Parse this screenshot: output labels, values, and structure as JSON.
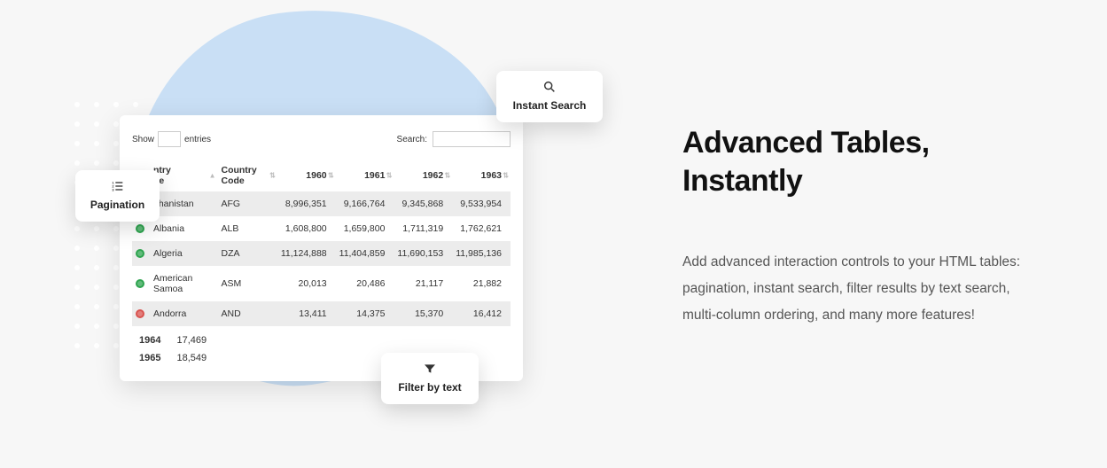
{
  "heading": "Advanced Tables, Instantly",
  "description": "Add advanced interaction controls to your HTML tables: pagination, instant search, filter results by text search, multi-column ordering, and many more features!",
  "chips": {
    "instant_search": "Instant Search",
    "pagination": "Pagination",
    "filter": "Filter by text"
  },
  "table": {
    "show_label_before": "Show",
    "show_label_after": "entries",
    "search_label": "Search:",
    "columns": {
      "country_name_a": "ntry",
      "country_name_b": "ne",
      "country_code": "Country Code",
      "y1960": "1960",
      "y1961": "1961",
      "y1962": "1962",
      "y1963": "1963"
    },
    "rows": [
      {
        "status": "green",
        "country": "ghanistan",
        "code": "AFG",
        "v": [
          "8,996,351",
          "9,166,764",
          "9,345,868",
          "9,533,954"
        ]
      },
      {
        "status": "green",
        "country": "Albania",
        "code": "ALB",
        "v": [
          "1,608,800",
          "1,659,800",
          "1,711,319",
          "1,762,621"
        ]
      },
      {
        "status": "green",
        "country": "Algeria",
        "code": "DZA",
        "v": [
          "11,124,888",
          "11,404,859",
          "11,690,153",
          "11,985,136"
        ]
      },
      {
        "status": "green",
        "country": "American Samoa",
        "code": "ASM",
        "v": [
          "20,013",
          "20,486",
          "21,117",
          "21,882"
        ]
      },
      {
        "status": "red",
        "country": "Andorra",
        "code": "AND",
        "v": [
          "13,411",
          "14,375",
          "15,370",
          "16,412"
        ]
      }
    ],
    "extra_rows": [
      {
        "year": "1964",
        "value": "17,469"
      },
      {
        "year": "1965",
        "value": "18,549"
      }
    ]
  }
}
